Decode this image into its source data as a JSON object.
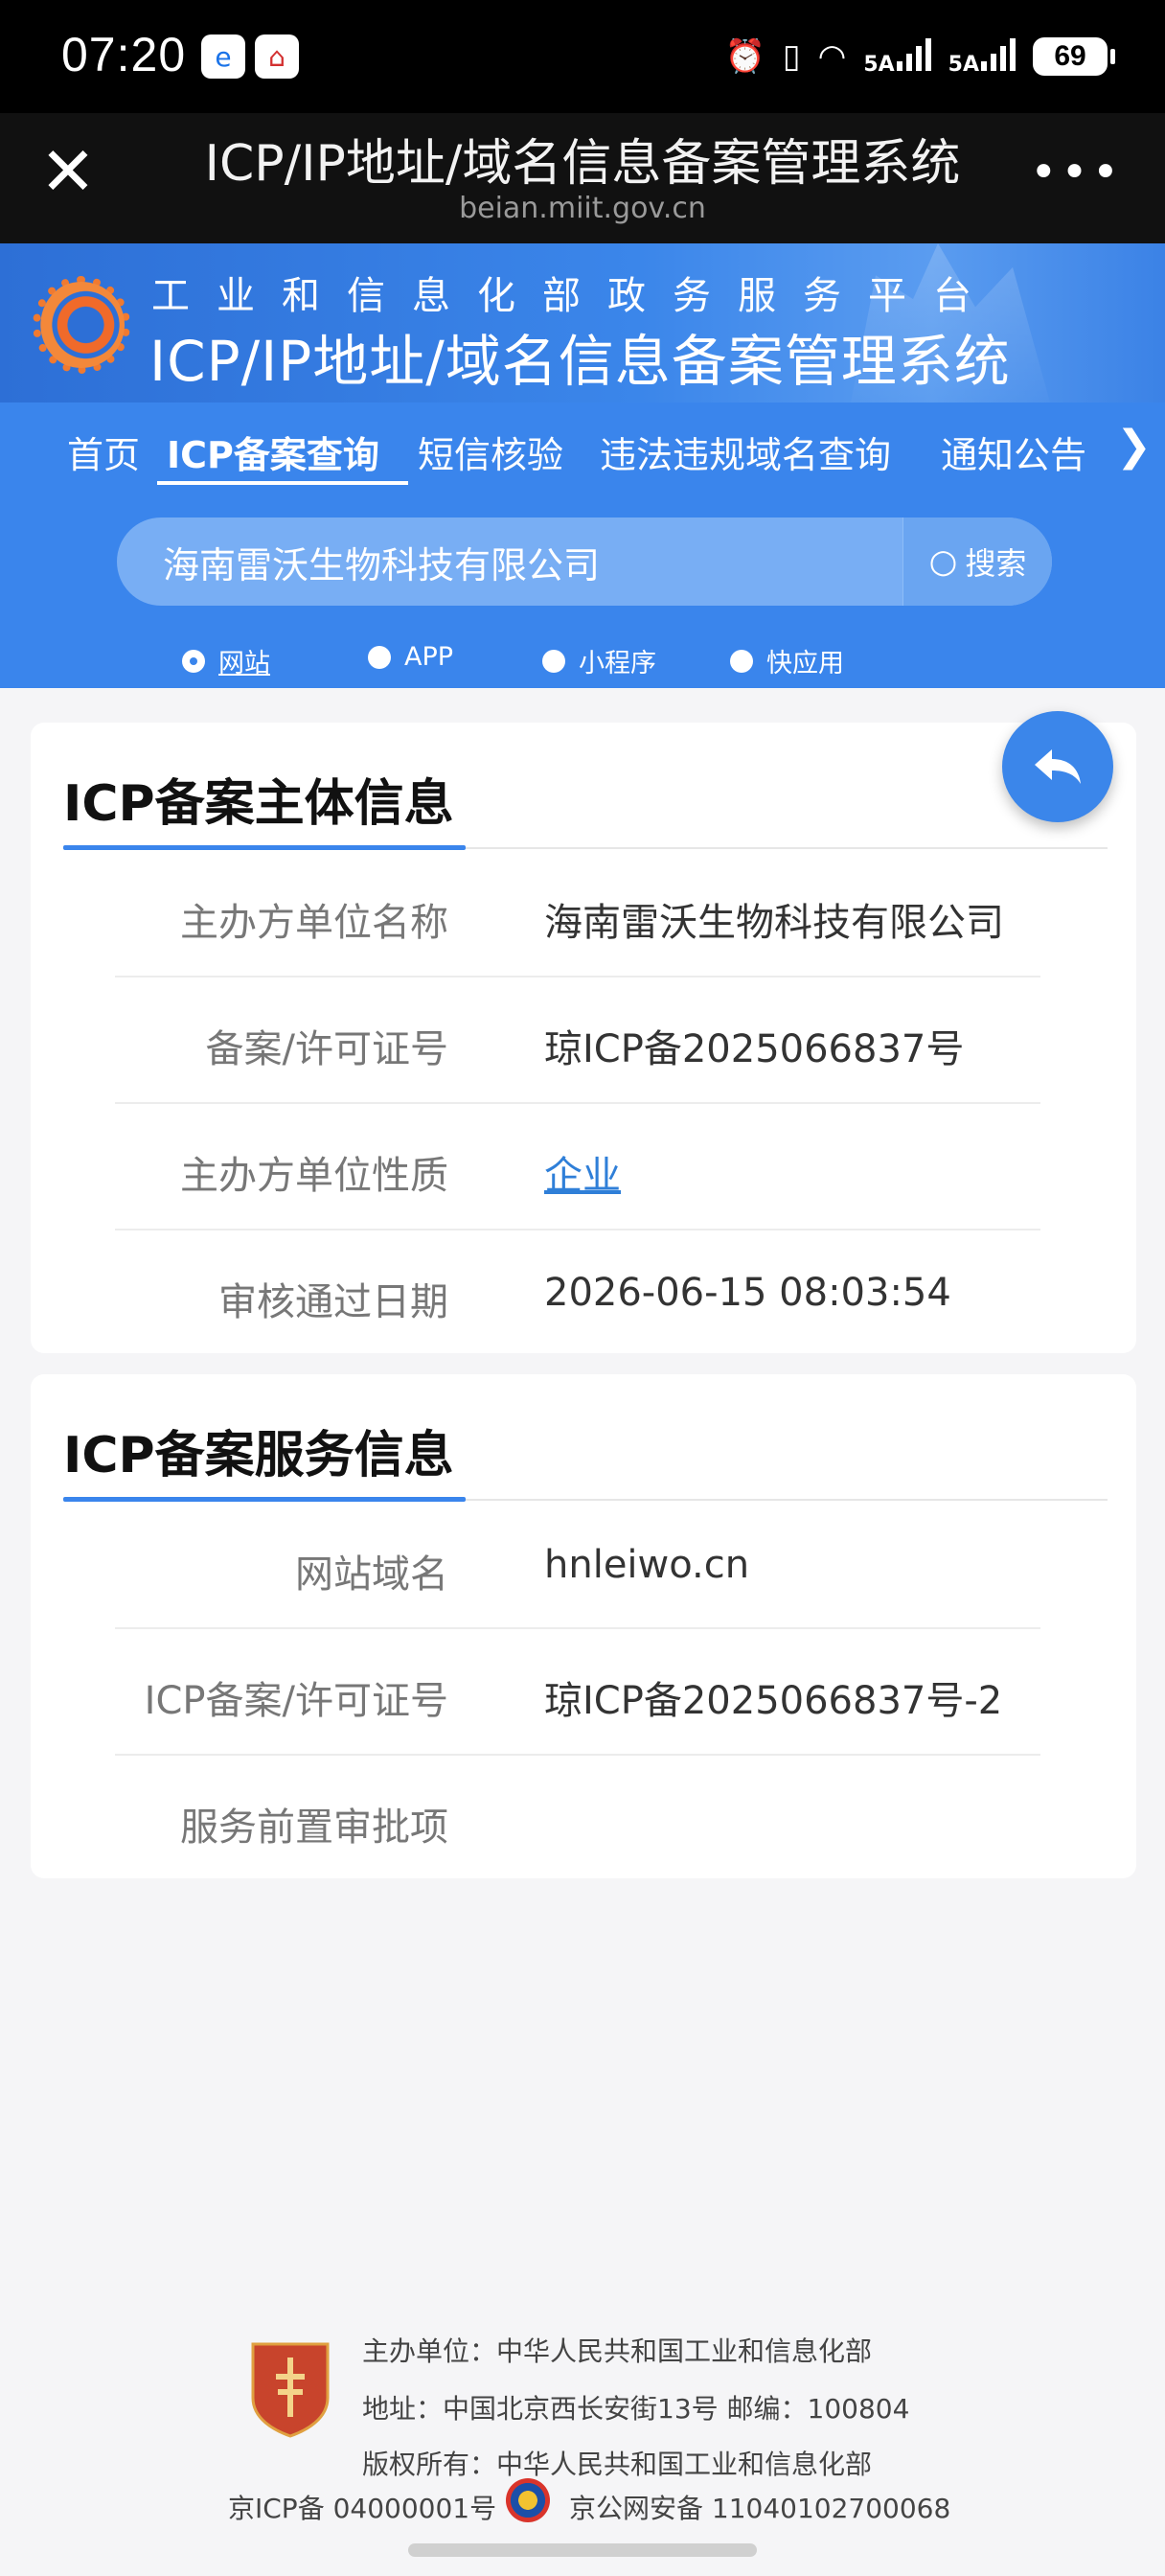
{
  "status_bar": {
    "time": "07:20",
    "sig1": "5A",
    "sig2": "5A",
    "battery": "69"
  },
  "browser": {
    "title": "ICP/IP地址/域名信息备案管理系统",
    "url": "beian.miit.gov.cn"
  },
  "site": {
    "subtitle": "工业和信息化部政务服务平台",
    "title": "ICP/IP地址/域名信息备案管理系统"
  },
  "nav": {
    "items": [
      "首页",
      "ICP备案查询",
      "短信核验",
      "违法违规域名查询",
      "通知公告"
    ],
    "active": "ICP备案查询"
  },
  "search": {
    "value": "海南雷沃生物科技有限公司",
    "button": "搜索"
  },
  "types": [
    "网站",
    "APP",
    "小程序",
    "快应用"
  ],
  "subject_card": {
    "title": "ICP备案主体信息",
    "rows": [
      {
        "label": "主办方单位名称",
        "value": "海南雷沃生物科技有限公司"
      },
      {
        "label": "备案/许可证号",
        "value": "琼ICP备2025066837号"
      },
      {
        "label": "主办方单位性质",
        "value": "企业"
      },
      {
        "label": "审核通过日期",
        "value": "2026-06-15 08:03:54"
      }
    ]
  },
  "service_card": {
    "title": "ICP备案服务信息",
    "rows": [
      {
        "label": "网站域名",
        "value": "hnleiwo.cn"
      },
      {
        "label": "ICP备案/许可证号",
        "value": "琼ICP备2025066837号-2"
      },
      {
        "label": "服务前置审批项",
        "value": ""
      }
    ]
  },
  "footer": {
    "host": "主办单位：中华人民共和国工业和信息化部",
    "address": "地址：中国北京西长安街13号 邮编：100804",
    "copyright": "版权所有：中华人民共和国工业和信息化部",
    "icp": "京ICP备 04000001号",
    "police": "京公网安备 11040102700068"
  },
  "colors": {
    "primary": "#3a85ec",
    "link": "#2f7fd8"
  }
}
